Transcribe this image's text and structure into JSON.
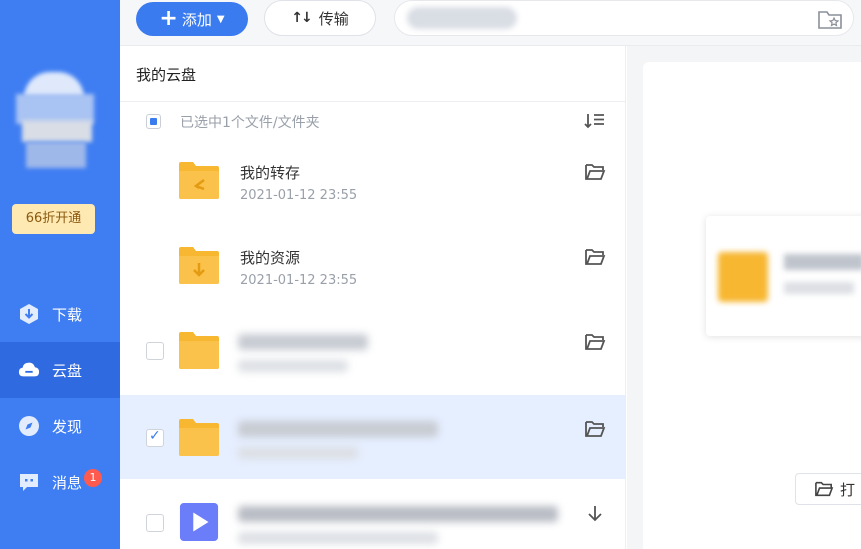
{
  "sidebar": {
    "vip_label": "66折开通",
    "items": [
      {
        "label": "下载",
        "icon": "download-icon"
      },
      {
        "label": "云盘",
        "icon": "cloud-icon"
      },
      {
        "label": "发现",
        "icon": "compass-icon"
      },
      {
        "label": "消息",
        "icon": "message-icon",
        "badge": "1"
      }
    ],
    "active_item": "云盘"
  },
  "toolbar": {
    "add_label": "添加",
    "transfer_label": "传输",
    "transfer_icon": "transfer-arrows-icon",
    "search_icon_right": "star-folder-icon"
  },
  "filelist": {
    "breadcrumb": "我的云盘",
    "selection_text": "已选中1个文件/文件夹",
    "sort_icon": "sort-icon",
    "rows": [
      {
        "name": "我的转存",
        "date": "2021-01-12 23:55",
        "icon": "folder-transfer-icon",
        "action_icon": "open-folder-icon"
      },
      {
        "name": "我的资源",
        "date": "2021-01-12 23:55",
        "icon": "folder-download-icon",
        "action_icon": "open-folder-icon"
      },
      {
        "name": "",
        "date": "",
        "icon": "folder-icon",
        "action_icon": "open-folder-icon",
        "checked": false
      },
      {
        "name": "",
        "date": "",
        "icon": "folder-icon",
        "action_icon": "open-folder-icon",
        "checked": true
      },
      {
        "name": "",
        "date": "",
        "icon": "video-file-icon",
        "action_icon": "download-arrow-icon",
        "checked": false
      }
    ]
  },
  "detail": {
    "open_button_label": "打"
  },
  "colors": {
    "sidebar": "#3f7ef2",
    "accent": "#3b7bf0",
    "folder": "#f7b731",
    "selected_row": "#e6efff",
    "badge": "#ff5a4e"
  }
}
